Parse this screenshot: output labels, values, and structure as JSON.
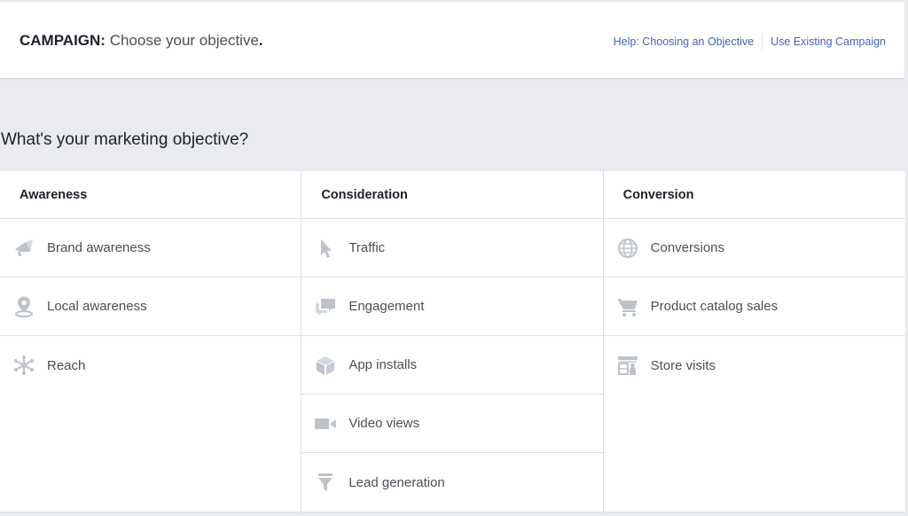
{
  "header": {
    "title_label": "CAMPAIGN:",
    "title_text": "Choose your objective",
    "title_punct": ".",
    "help_link": "Help: Choosing an Objective",
    "existing_link": "Use Existing Campaign"
  },
  "question": "What's your marketing objective?",
  "colors": {
    "link": "#4267b2",
    "icon": "#bec3c9",
    "background": "#e9ebee"
  },
  "columns": [
    {
      "heading": "Awareness",
      "items": [
        {
          "label": "Brand awareness",
          "icon": "megaphone-icon"
        },
        {
          "label": "Local awareness",
          "icon": "location-pin-icon"
        },
        {
          "label": "Reach",
          "icon": "asterisk-burst-icon"
        }
      ]
    },
    {
      "heading": "Consideration",
      "items": [
        {
          "label": "Traffic",
          "icon": "cursor-arrow-icon"
        },
        {
          "label": "Engagement",
          "icon": "chat-bubbles-icon"
        },
        {
          "label": "App installs",
          "icon": "package-box-icon"
        },
        {
          "label": "Video views",
          "icon": "video-camera-icon"
        },
        {
          "label": "Lead generation",
          "icon": "funnel-icon"
        }
      ]
    },
    {
      "heading": "Conversion",
      "items": [
        {
          "label": "Conversions",
          "icon": "globe-icon"
        },
        {
          "label": "Product catalog sales",
          "icon": "shopping-cart-icon"
        },
        {
          "label": "Store visits",
          "icon": "storefront-icon"
        }
      ]
    }
  ]
}
